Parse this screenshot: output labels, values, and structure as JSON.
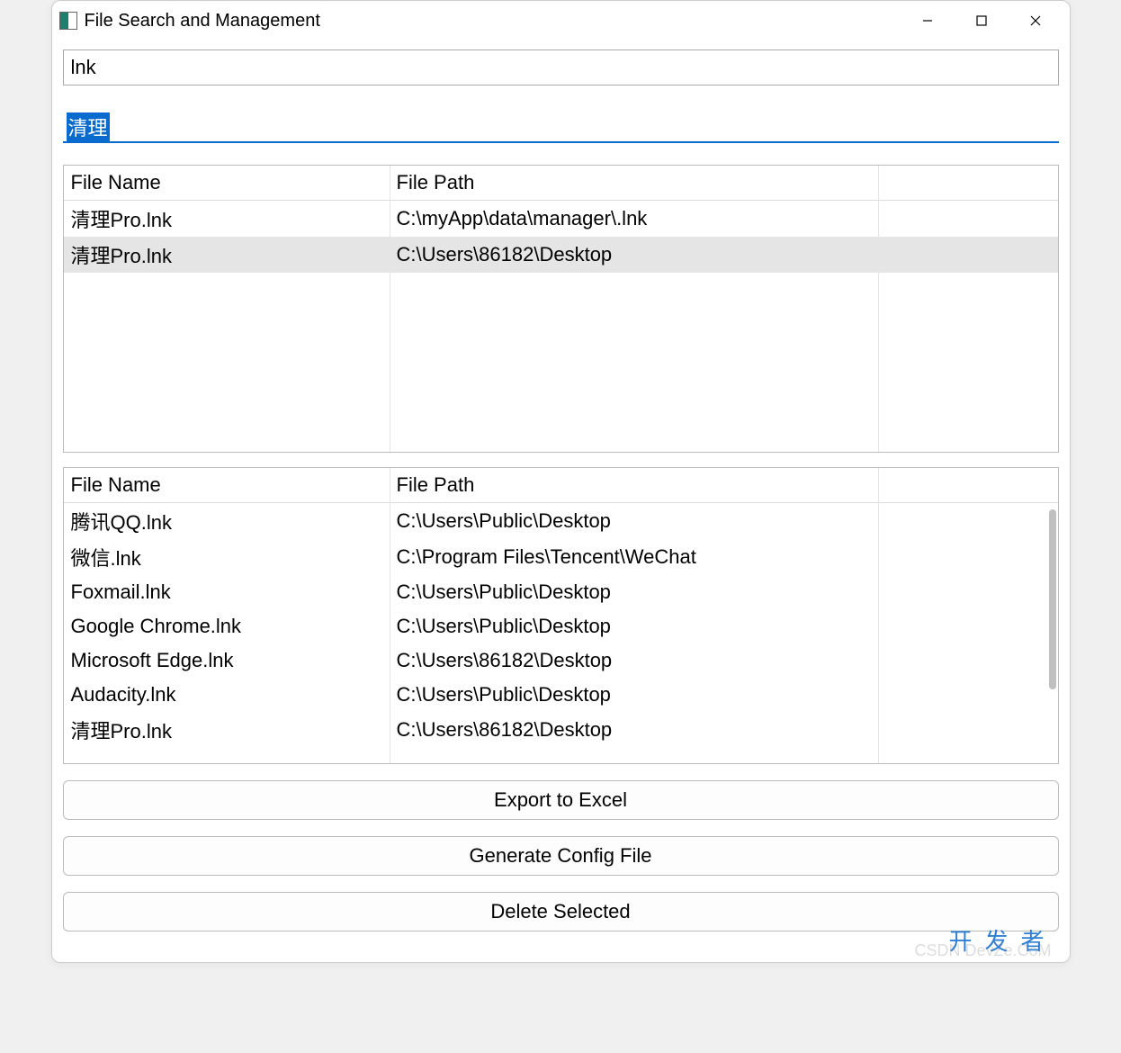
{
  "window": {
    "title": "File Search and Management"
  },
  "inputs": {
    "search_value": "lnk",
    "filter_value": "清理"
  },
  "top_table": {
    "headers": {
      "name": "File Name",
      "path": "File Path"
    },
    "rows": [
      {
        "name": "清理Pro.lnk",
        "path": "C:\\myApp\\data\\manager\\.lnk",
        "selected": false
      },
      {
        "name": "清理Pro.lnk",
        "path": "C:\\Users\\86182\\Desktop",
        "selected": true
      }
    ]
  },
  "bottom_table": {
    "headers": {
      "name": "File Name",
      "path": "File Path"
    },
    "rows": [
      {
        "name": "腾讯QQ.lnk",
        "path": "C:\\Users\\Public\\Desktop"
      },
      {
        "name": "微信.lnk",
        "path": "C:\\Program Files\\Tencent\\WeChat"
      },
      {
        "name": "Foxmail.lnk",
        "path": "C:\\Users\\Public\\Desktop"
      },
      {
        "name": "Google Chrome.lnk",
        "path": "C:\\Users\\Public\\Desktop"
      },
      {
        "name": "Microsoft Edge.lnk",
        "path": "C:\\Users\\86182\\Desktop"
      },
      {
        "name": "Audacity.lnk",
        "path": "C:\\Users\\Public\\Desktop"
      },
      {
        "name": "清理Pro.lnk",
        "path": "C:\\Users\\86182\\Desktop"
      }
    ]
  },
  "buttons": {
    "export": "Export to Excel",
    "generate": "Generate Config File",
    "delete": "Delete Selected"
  },
  "watermark": {
    "main": "开发者",
    "sub": "CSDN DevZe.CoM"
  }
}
